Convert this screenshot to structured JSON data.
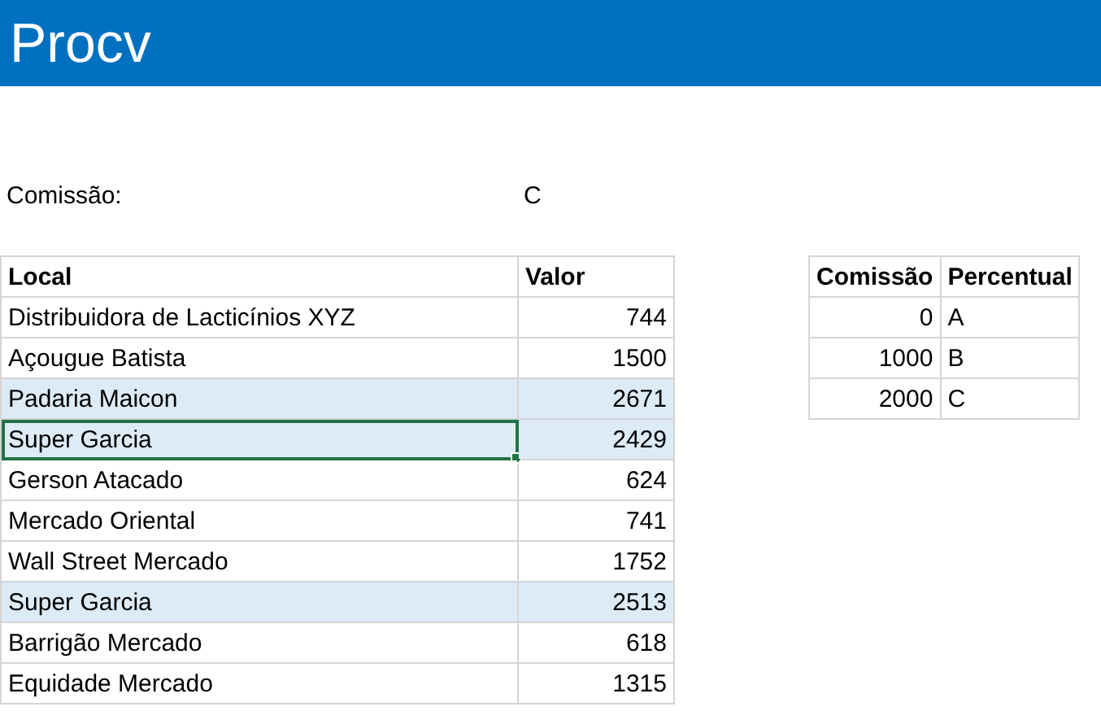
{
  "title": "Procv",
  "lookup": {
    "label": "Comissão:",
    "value": "C"
  },
  "main_table": {
    "columns": [
      "Local",
      "Valor"
    ],
    "rows": [
      {
        "local": "Distribuidora de Lacticínios XYZ",
        "valor": "744",
        "highlighted": false,
        "selected": false
      },
      {
        "local": "Açougue Batista",
        "valor": "1500",
        "highlighted": false,
        "selected": false
      },
      {
        "local": "Padaria Maicon",
        "valor": "2671",
        "highlighted": true,
        "selected": false
      },
      {
        "local": "Super Garcia",
        "valor": "2429",
        "highlighted": true,
        "selected": true
      },
      {
        "local": "Gerson Atacado",
        "valor": "624",
        "highlighted": false,
        "selected": false
      },
      {
        "local": "Mercado Oriental",
        "valor": "741",
        "highlighted": false,
        "selected": false
      },
      {
        "local": "Wall Street Mercado",
        "valor": "1752",
        "highlighted": false,
        "selected": false
      },
      {
        "local": "Super Garcia",
        "valor": "2513",
        "highlighted": true,
        "selected": false
      },
      {
        "local": "Barrigão Mercado",
        "valor": "618",
        "highlighted": false,
        "selected": false
      },
      {
        "local": "Equidade Mercado",
        "valor": "1315",
        "highlighted": false,
        "selected": false
      }
    ]
  },
  "commission_table": {
    "columns": [
      "Comissão",
      "Percentual"
    ],
    "rows": [
      {
        "threshold": "0",
        "grade": "A"
      },
      {
        "threshold": "1000",
        "grade": "B"
      },
      {
        "threshold": "2000",
        "grade": "C"
      }
    ]
  }
}
